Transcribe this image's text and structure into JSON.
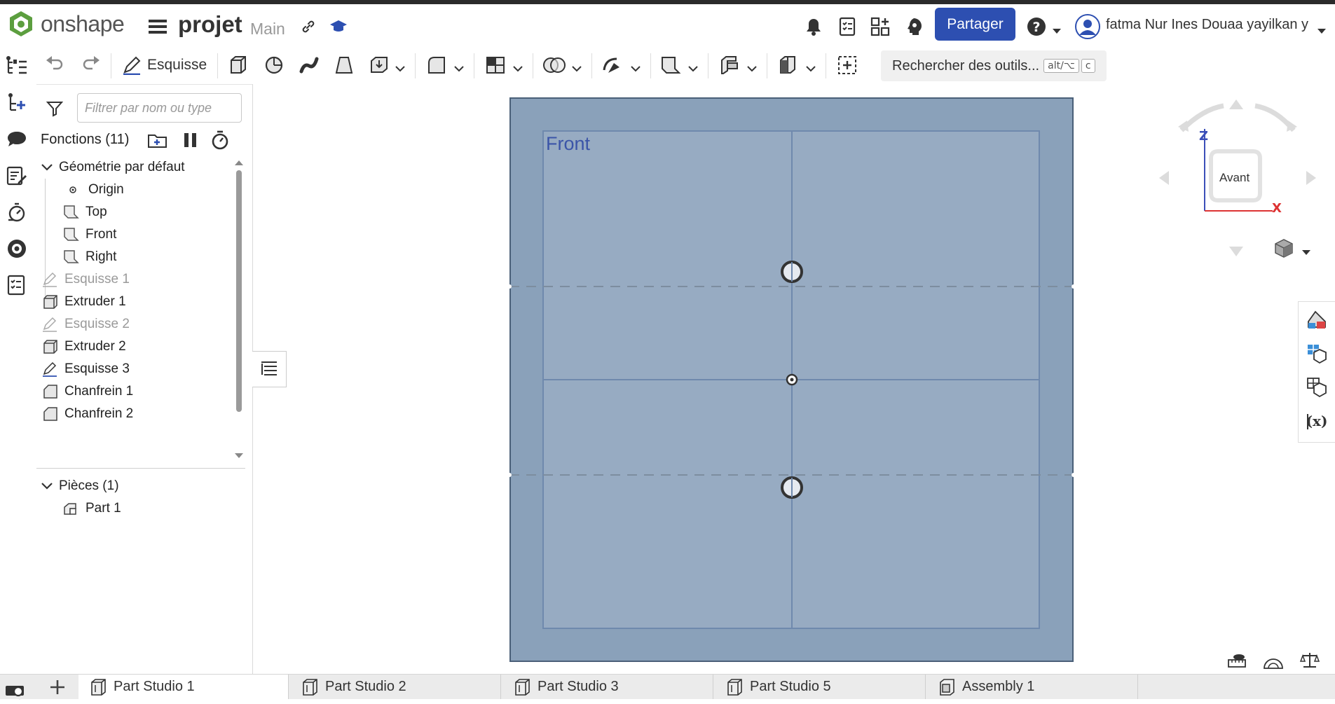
{
  "header": {
    "logo_text": "onshape",
    "document_name": "projet",
    "branch": "Main",
    "share_label": "Partager",
    "user_name": "fatma Nur Ines Douaa yayilkan y"
  },
  "toolbar": {
    "sketch_label": "Esquisse",
    "search_tools_label": "Rechercher des outils...",
    "shortcut_key_1": "alt/⌥",
    "shortcut_key_2": "c"
  },
  "panel": {
    "filter_placeholder": "Filtrer par nom ou type",
    "features_title": "Fonctions (11)",
    "default_geometry_label": "Géométrie par défaut",
    "origin_label": "Origin",
    "top_label": "Top",
    "front_label": "Front",
    "right_label": "Right",
    "features": [
      {
        "label": "Esquisse 1"
      },
      {
        "label": "Extruder 1"
      },
      {
        "label": "Esquisse 2"
      },
      {
        "label": "Extruder 2"
      },
      {
        "label": "Esquisse 3"
      },
      {
        "label": "Chanfrein 1"
      },
      {
        "label": "Chanfrein 2"
      }
    ],
    "parts_title": "Pièces (1)",
    "part_label": "Part 1"
  },
  "viewport": {
    "plane_label": "Front",
    "view_cube_label": "Avant",
    "axis_z": "Z",
    "axis_x": "X"
  },
  "tabs": [
    {
      "label": "Part Studio 1"
    },
    {
      "label": "Part Studio 2"
    },
    {
      "label": "Part Studio 3"
    },
    {
      "label": "Part Studio 5"
    },
    {
      "label": "Assembly 1"
    }
  ],
  "colors": {
    "accent": "#2d4fb1",
    "plane_fill": "#8aa1ba",
    "plane_inner": "#97abc2",
    "logo_green": "#5c9e3f"
  }
}
